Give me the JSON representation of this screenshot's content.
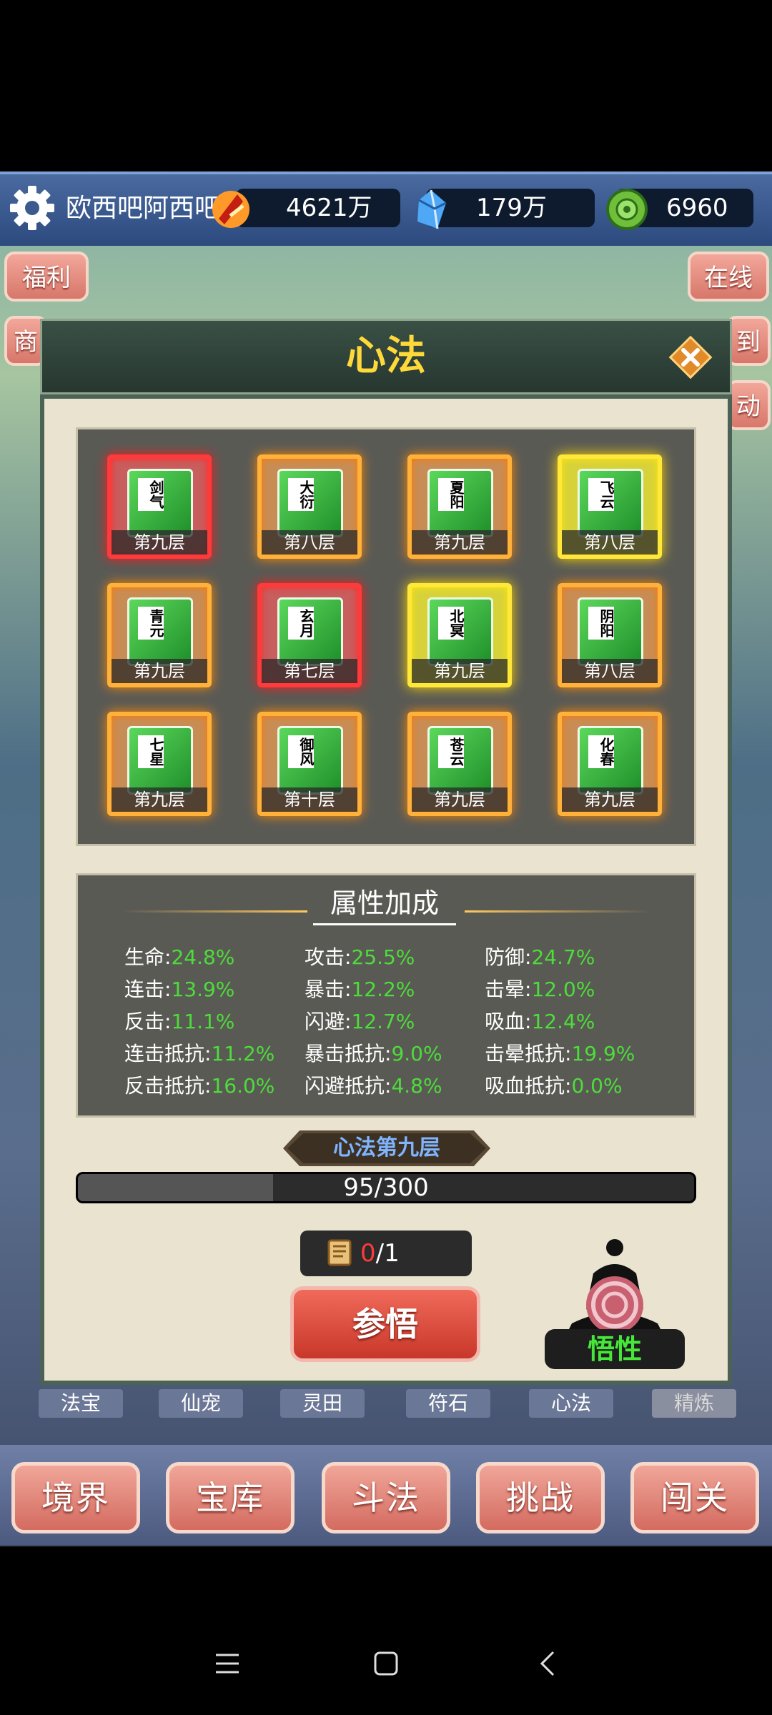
{
  "header": {
    "username": "欧西吧阿西吧",
    "resources": [
      {
        "icon": "battle-power-icon",
        "value": "4621万"
      },
      {
        "icon": "crystal-icon",
        "value": "179万"
      },
      {
        "icon": "jade-coin-icon",
        "value": "6960"
      }
    ]
  },
  "side_buttons": {
    "left": [
      "福利",
      "商"
    ],
    "right": [
      "在线",
      "到",
      "动"
    ]
  },
  "dialog": {
    "title": "心法",
    "books": [
      {
        "name": "剑气",
        "layer": "第九层",
        "tier": "red"
      },
      {
        "name": "大衍",
        "layer": "第八层",
        "tier": "orange"
      },
      {
        "name": "夏阳",
        "layer": "第九层",
        "tier": "orange"
      },
      {
        "name": "飞云",
        "layer": "第八层",
        "tier": "yellow"
      },
      {
        "name": "青元",
        "layer": "第九层",
        "tier": "orange"
      },
      {
        "name": "玄月",
        "layer": "第七层",
        "tier": "red"
      },
      {
        "name": "北冥",
        "layer": "第九层",
        "tier": "yellow"
      },
      {
        "name": "阴阳",
        "layer": "第八层",
        "tier": "orange"
      },
      {
        "name": "七星",
        "layer": "第九层",
        "tier": "orange"
      },
      {
        "name": "御风",
        "layer": "第十层",
        "tier": "orange"
      },
      {
        "name": "苍云",
        "layer": "第九层",
        "tier": "orange"
      },
      {
        "name": "化春",
        "layer": "第九层",
        "tier": "orange"
      }
    ],
    "attributes_title": "属性加成",
    "attributes": [
      {
        "label": "生命:",
        "value": "24.8%"
      },
      {
        "label": "攻击:",
        "value": "25.5%"
      },
      {
        "label": "防御:",
        "value": "24.7%"
      },
      {
        "label": "连击:",
        "value": "13.9%"
      },
      {
        "label": "暴击:",
        "value": "12.2%"
      },
      {
        "label": "击晕:",
        "value": "12.0%"
      },
      {
        "label": "反击:",
        "value": "11.1%"
      },
      {
        "label": "闪避:",
        "value": "12.7%"
      },
      {
        "label": "吸血:",
        "value": "12.4%"
      },
      {
        "label": "连击抵抗:",
        "value": "11.2%"
      },
      {
        "label": "暴击抵抗:",
        "value": "9.0%"
      },
      {
        "label": "击晕抵抗:",
        "value": "19.9%"
      },
      {
        "label": "反击抵抗:",
        "value": "16.0%"
      },
      {
        "label": "闪避抵抗:",
        "value": "4.8%"
      },
      {
        "label": "吸血抵抗:",
        "value": "0.0%"
      }
    ],
    "level_label": "心法第九层",
    "progress": {
      "text": "95/300",
      "fraction": 0.3167
    },
    "cost": {
      "have": "0",
      "need": "/1",
      "have_color": "#ff3a3a"
    },
    "comprehend_button": "参悟",
    "enlighten_label": "悟性"
  },
  "tabs": [
    "法宝",
    "仙宠",
    "灵田",
    "符石",
    "心法",
    "精炼"
  ],
  "bottom_nav": [
    "境界",
    "宝库",
    "斗法",
    "挑战",
    "闯关"
  ],
  "colors": {
    "title_yellow": "#ffd83a",
    "attr_value_green": "#4ddd3a",
    "level_blue": "#7fb4ff",
    "enlighten_green": "#45e838"
  }
}
